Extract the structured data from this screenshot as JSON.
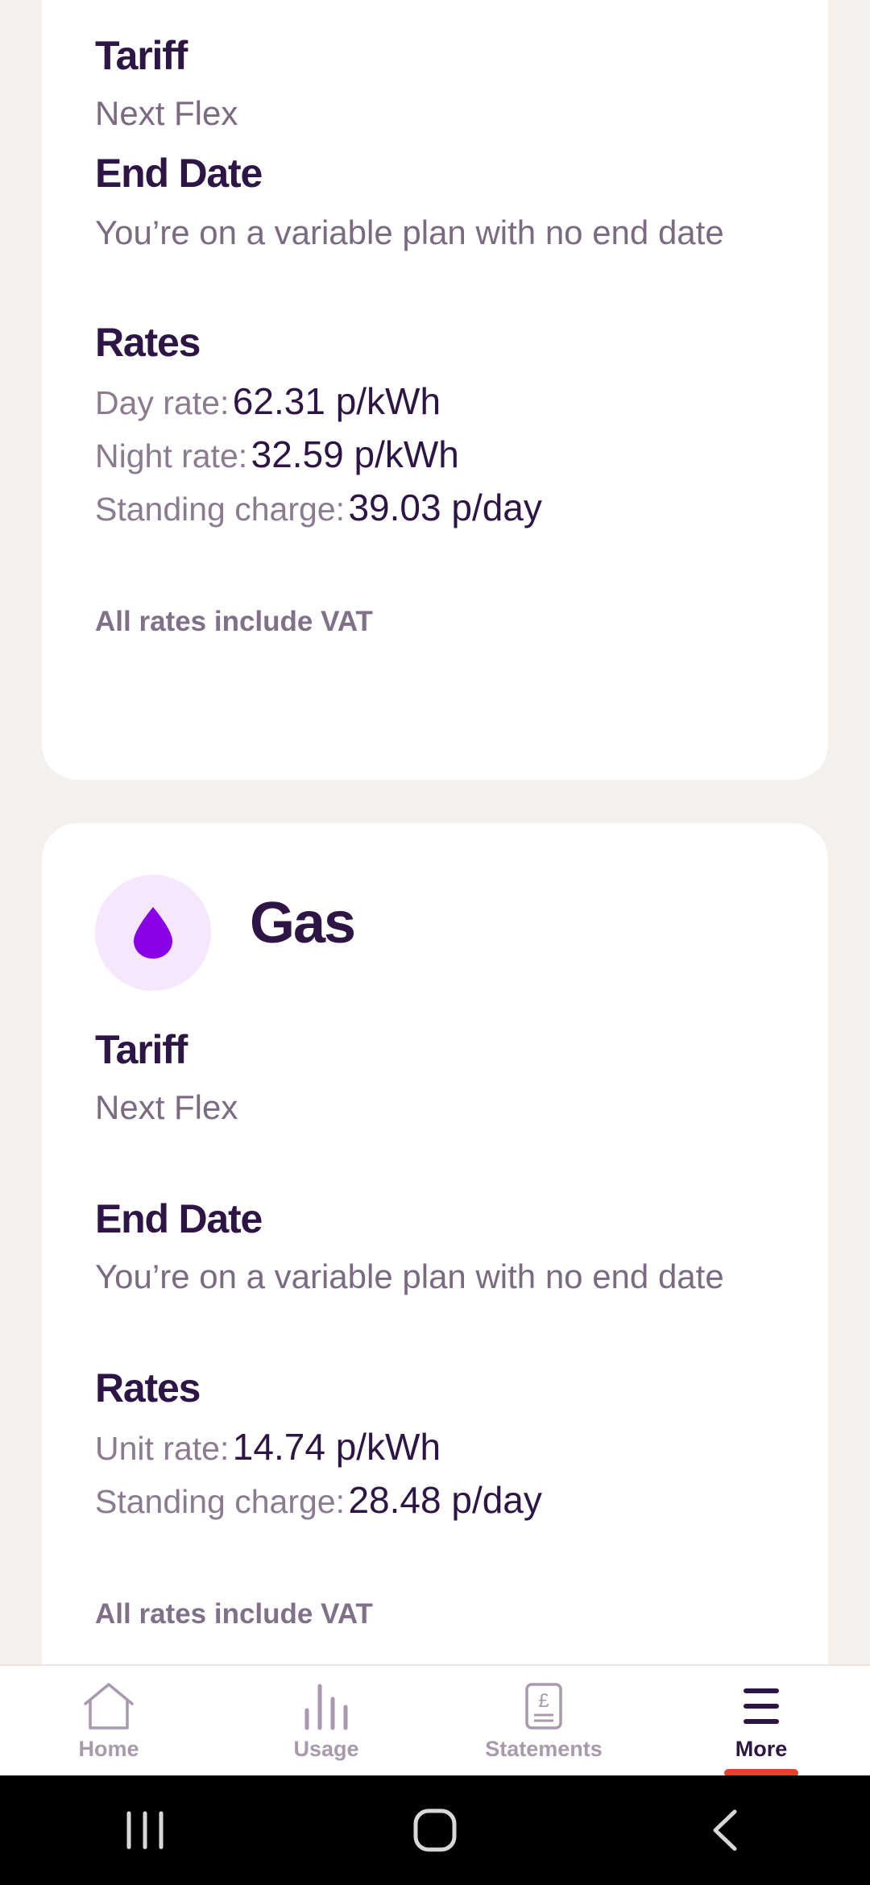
{
  "electricity": {
    "tariff_label": "Tariff",
    "tariff_value": "Next Flex",
    "end_date_label": "End Date",
    "end_date_value": "You’re on a variable plan with no end date",
    "rates_label": "Rates",
    "rates": [
      {
        "label": "Day rate:",
        "value": "62.31 p/kWh"
      },
      {
        "label": "Night rate:",
        "value": "32.59 p/kWh"
      },
      {
        "label": "Standing charge:",
        "value": "39.03 p/day"
      }
    ],
    "vat_note": "All rates include VAT"
  },
  "gas": {
    "title": "Gas",
    "icon": "flame-drop-icon",
    "tariff_label": "Tariff",
    "tariff_value": "Next Flex",
    "end_date_label": "End Date",
    "end_date_value": "You’re on a variable plan with no end date",
    "rates_label": "Rates",
    "rates": [
      {
        "label": "Unit rate:",
        "value": "14.74 p/kWh"
      },
      {
        "label": "Standing charge:",
        "value": "28.48 p/day"
      }
    ],
    "vat_note": "All rates include VAT"
  },
  "bottom_nav": {
    "items": [
      {
        "label": "Home",
        "icon": "home-icon"
      },
      {
        "label": "Usage",
        "icon": "bar-chart-icon"
      },
      {
        "label": "Statements",
        "icon": "receipt-icon"
      },
      {
        "label": "More",
        "icon": "menu-icon"
      }
    ],
    "active": "More"
  },
  "colors": {
    "background": "#f4f0ed",
    "card": "#ffffff",
    "heading": "#2d1645",
    "accent_purple": "#8a00e6",
    "active_indicator": "#e8412c"
  }
}
